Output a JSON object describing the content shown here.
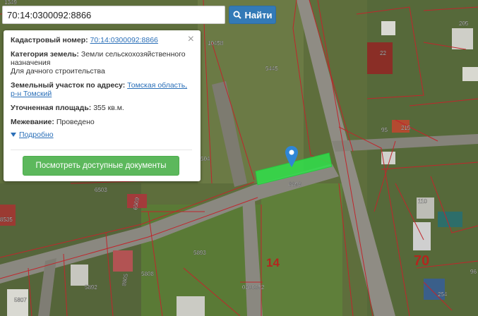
{
  "search": {
    "value": "70:14:0300092:8866",
    "button_label": "Найти"
  },
  "popup": {
    "cadastral_label": "Кадастровый номер:",
    "cadastral_value": "70:14:0300092:8866",
    "category_label": "Категория земель:",
    "category_value": "Земли сельскохозяйственного назначения",
    "usage_value": "Для дачного строительства",
    "address_label": "Земельный участок по адресу:",
    "address_value": "Томская область, р-н Томский",
    "area_label": "Уточненная площадь:",
    "area_value": "355 кв.м.",
    "survey_label": "Межевание:",
    "survey_value": "Проведено",
    "more_link": "Подробно",
    "docs_button": "Посмотреть доступные документы",
    "close_symbol": "×"
  },
  "map_labels": {
    "l205": "205",
    "l10458": "10458",
    "l5445": "5445",
    "l22": "22",
    "l95": "95",
    "l215": "215",
    "l504": "504",
    "l8898": "8898",
    "l6503": "6503",
    "l6509": "6509",
    "l110": "110",
    "l5893": "5893",
    "l14": "14",
    "l70": "70",
    "l5808": "5808",
    "l5892": "5892",
    "l8805": "8805",
    "l0300092": "0300092",
    "l5807": "5807",
    "l254": "254",
    "l96": "96",
    "l1349": "1349",
    "l8535": "8535"
  },
  "colors": {
    "parcel_border": "#c0262c",
    "highlight": "#2fe04a",
    "search_button": "#337ab7",
    "docs_button": "#5cb85c",
    "link": "#2a6fb8"
  },
  "icons": {
    "search": "search-icon",
    "marker": "map-marker-icon",
    "close": "close-icon",
    "expand": "triangle-down-icon"
  }
}
